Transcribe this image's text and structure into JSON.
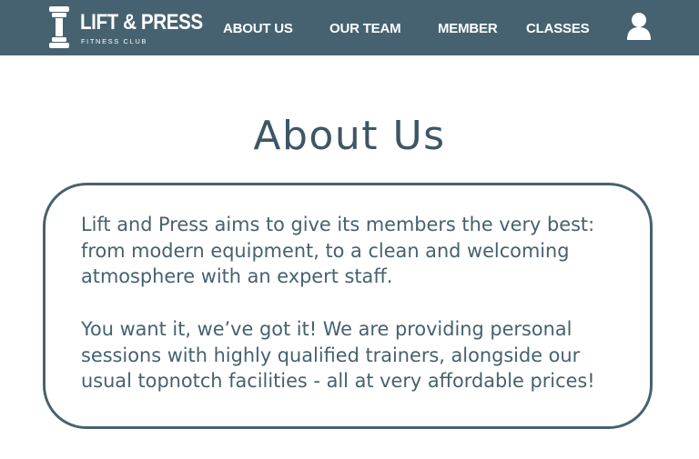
{
  "brand": {
    "name": "LIFT & PRESS",
    "tagline": "FITNESS CLUB"
  },
  "nav": {
    "items": [
      {
        "label": "ABOUT US"
      },
      {
        "label": "OUR TEAM"
      },
      {
        "label": "MEMBER"
      },
      {
        "label": "CLASSES"
      }
    ],
    "user_icon": "user-icon"
  },
  "main": {
    "title": "About Us",
    "paragraphs": [
      "Lift and Press aims to give its members the very best: from modern equipment, to a clean and welcoming atmosphere with an expert staff.",
      "You want it, we’ve got it! We are providing personal sessions with highly qualified trainers, alongside our usual topnotch facilities - all at very affordable prices!"
    ]
  },
  "colors": {
    "navbar": "#466270",
    "text": "#3f5a68",
    "border": "#466270",
    "background": "#ffffff"
  }
}
